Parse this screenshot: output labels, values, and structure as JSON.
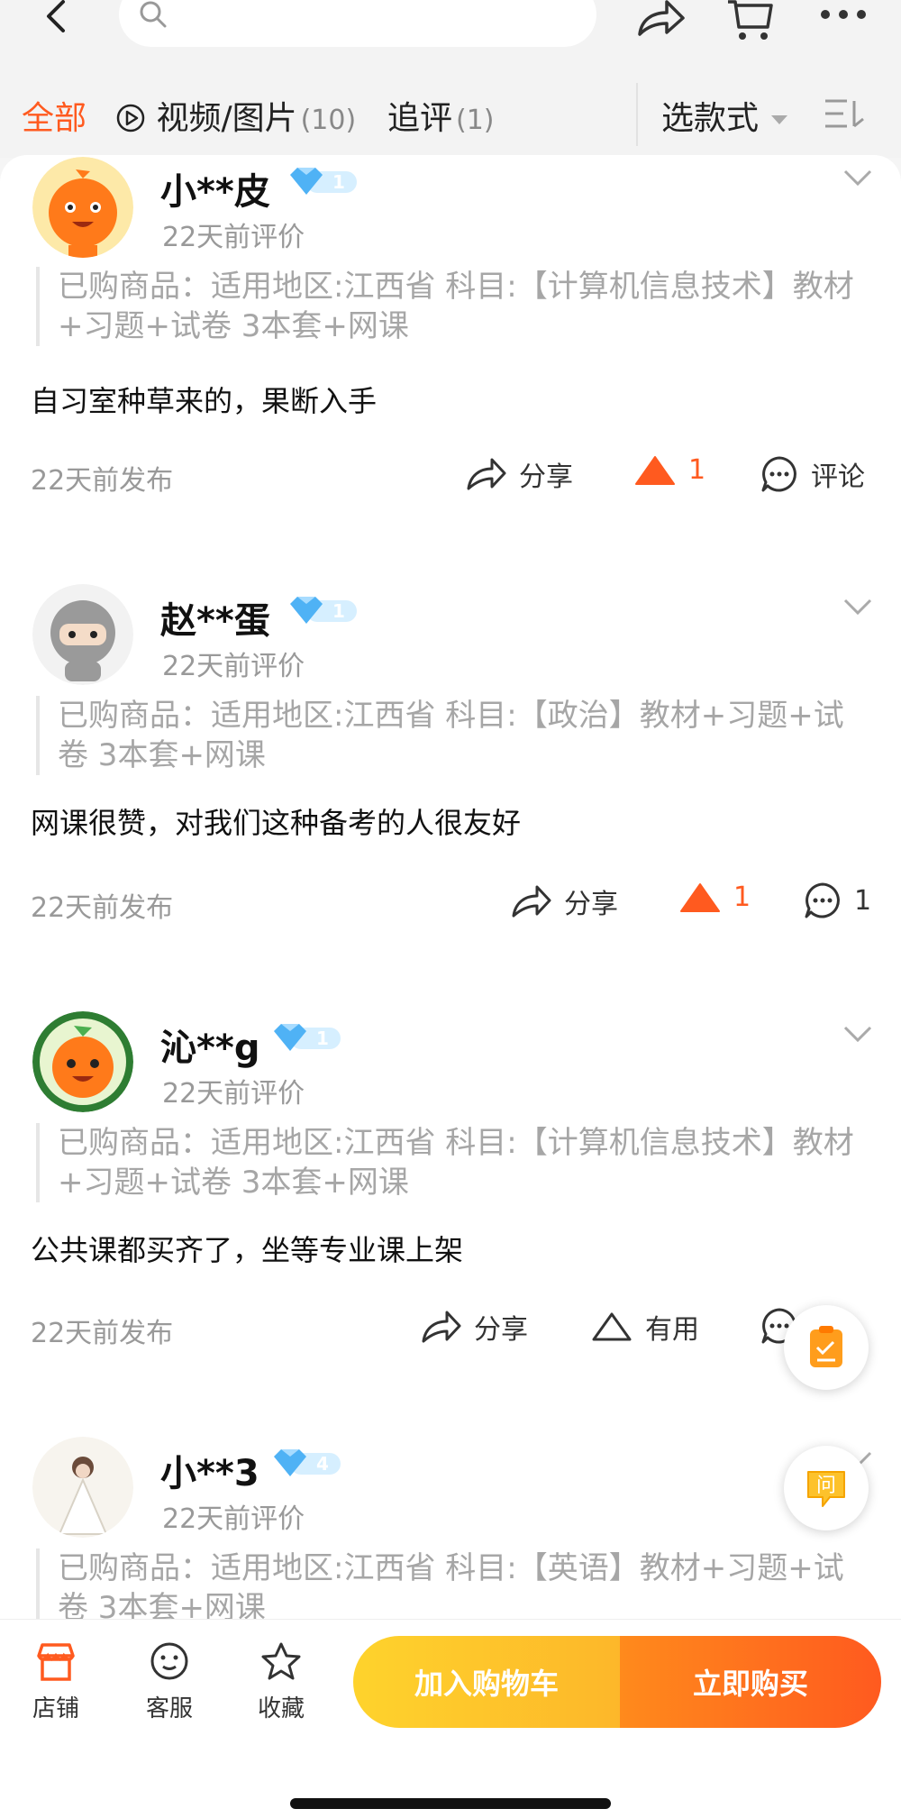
{
  "tabs": {
    "all": "全部",
    "media": "视频/图片",
    "media_count": "(10)",
    "followup": "追评",
    "followup_count": "(1)",
    "style": "选款式"
  },
  "reviews": [
    {
      "username": "小**皮",
      "level": "1",
      "review_time": "22天前评价",
      "purchased": "已购商品：适用地区:江西省 科目:【计算机信息技术】教材+习题+试卷 3本套+网课",
      "text": "自习室种草来的，果断入手",
      "publish_time": "22天前发布",
      "share": "分享",
      "likes": "1",
      "comment": "评论"
    },
    {
      "username": "赵**蛋",
      "level": "1",
      "review_time": "22天前评价",
      "purchased": "已购商品：适用地区:江西省 科目:【政治】教材+习题+试卷 3本套+网课",
      "text": "网课很赞，对我们这种备考的人很友好",
      "publish_time": "22天前发布",
      "share": "分享",
      "likes": "1",
      "comment": "1"
    },
    {
      "username": "沁**g",
      "level": "1",
      "review_time": "22天前评价",
      "purchased": "已购商品：适用地区:江西省 科目:【计算机信息技术】教材+习题+试卷 3本套+网课",
      "text": "公共课都买齐了，坐等专业课上架",
      "publish_time": "22天前发布",
      "share": "分享",
      "useful": "有用"
    },
    {
      "username": "小**3",
      "level": "4",
      "review_time": "22天前评价",
      "purchased": "已购商品：适用地区:江西省 科目:【英语】教材+习题+试卷 3本套+网课"
    }
  ],
  "float": {
    "ask_label": "问"
  },
  "bottom": {
    "shop": "店铺",
    "service": "客服",
    "favorite": "收藏",
    "add_to_cart": "加入购物车",
    "buy_now": "立即购买"
  },
  "colors": {
    "accent": "#ff5a1f",
    "cart": "#fdc22b",
    "diamond": "#4fb2f5"
  }
}
